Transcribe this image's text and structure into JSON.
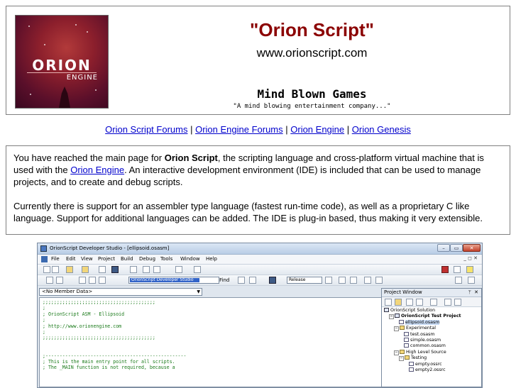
{
  "header": {
    "logo_text": "ORION",
    "logo_sub": "ENGINE",
    "title": "\"Orion Script\"",
    "url": "www.orionscript.com",
    "company": "Mind Blown Games",
    "tagline": "\"A mind blowing entertainment company...\""
  },
  "nav": {
    "links": [
      "Orion Script Forums",
      "Orion Engine Forums",
      "Orion Engine",
      "Orion Genesis"
    ],
    "separator": " | "
  },
  "intro": {
    "p1_before": "You have reached the main page for ",
    "p1_bold": "Orion Script",
    "p1_middle": ", the scripting language and cross-platform virtual machine that is used with the ",
    "p1_link": "Orion Engine",
    "p1_after": ".  An interactive development environment (IDE) is included that can be used to manage projects, and to create and debug scripts.",
    "p2": "Currently there is support for an assembler type language (fastest run-time code), as well as a proprietary C like language.  Support for additional languages can be added.  The IDE is plug-in based, thus making it very extensible."
  },
  "ide": {
    "title": "OrionScript Developer Studio - [ellipsoid.osasm]",
    "window_buttons": {
      "min": "–",
      "max": "▭",
      "close": "✕"
    },
    "menu": [
      "File",
      "Edit",
      "View",
      "Project",
      "Build",
      "Debug",
      "Tools",
      "Window",
      "Help"
    ],
    "menu_right": "_ ◻ ✕",
    "combo_studio": "OrionScript Developer Studio",
    "find_label": "Find",
    "build_config": "Release",
    "member_combo": "<No Member Data>",
    "code_lines": [
      ";;;;;;;;;;;;;;;;;;;;;;;;;;;;;;;;;;;;;;;;",
      ";",
      "; OrionScript ASM - Ellipsoid",
      ";",
      "; http://www.orionengine.com",
      ";",
      ";;;;;;;;;;;;;;;;;;;;;;;;;;;;;;;;;;;;;;;;",
      "",
      "",
      ";--------------------------------------------------",
      "; This is the main entry point for all scripts.",
      "; The _MAIN function is not required, because a"
    ],
    "project_window": {
      "title": "Project Window",
      "pin": "ᛘ",
      "close": "✕",
      "tree": [
        {
          "label": "OrionScript Solution",
          "kind": "sol",
          "indent": 0,
          "bold": false,
          "exp": ""
        },
        {
          "label": "OrionScript Test Project",
          "kind": "sol",
          "indent": 1,
          "bold": true,
          "exp": "−"
        },
        {
          "label": "ellipsoid.osasm",
          "kind": "file",
          "indent": 3,
          "bold": false,
          "exp": "",
          "selected": true
        },
        {
          "label": "Experimental",
          "kind": "folder",
          "indent": 2,
          "bold": false,
          "exp": "−"
        },
        {
          "label": "test.osasm",
          "kind": "file",
          "indent": 4,
          "bold": false,
          "exp": ""
        },
        {
          "label": "simple.osasm",
          "kind": "file",
          "indent": 4,
          "bold": false,
          "exp": ""
        },
        {
          "label": "common.osasm",
          "kind": "file",
          "indent": 4,
          "bold": false,
          "exp": ""
        },
        {
          "label": "High Level Source",
          "kind": "folder",
          "indent": 2,
          "bold": false,
          "exp": "−"
        },
        {
          "label": "Testing",
          "kind": "folder",
          "indent": 3,
          "bold": false,
          "exp": "−"
        },
        {
          "label": "empty.ossrc",
          "kind": "file",
          "indent": 5,
          "bold": false,
          "exp": ""
        },
        {
          "label": "empty2.ossrc",
          "kind": "file",
          "indent": 5,
          "bold": false,
          "exp": ""
        }
      ]
    }
  }
}
